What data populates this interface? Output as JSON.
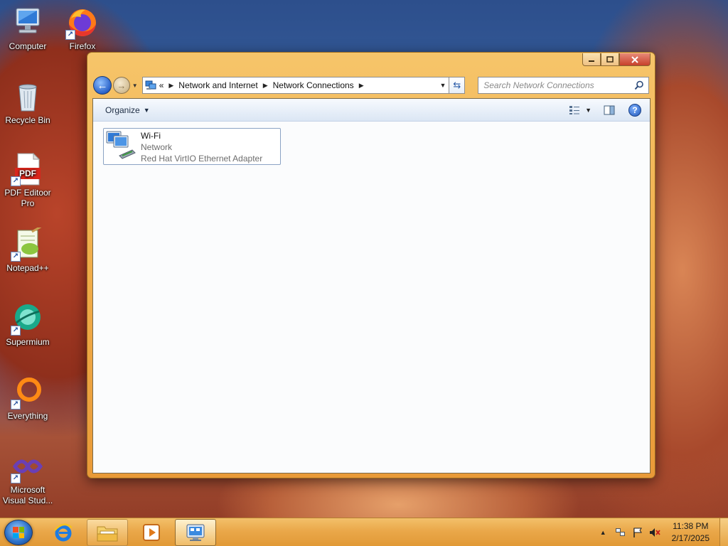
{
  "desktop": {
    "icons": [
      {
        "label": "Computer",
        "icon": "computer-icon"
      },
      {
        "label": "Firefox",
        "icon": "firefox-icon"
      },
      {
        "label": "Recycle Bin",
        "icon": "recycle-bin-icon"
      },
      {
        "label": "PDF Editoor Pro",
        "icon": "pdf-icon"
      },
      {
        "label": "Notepad++",
        "icon": "notepad-plus-plus-icon"
      },
      {
        "label": "Supermium",
        "icon": "supermium-icon"
      },
      {
        "label": "Everything",
        "icon": "everything-icon"
      },
      {
        "label": "Microsoft Visual Stud...",
        "icon": "visual-studio-icon"
      }
    ]
  },
  "window": {
    "breadcrumb": {
      "overflow": "«",
      "items": [
        "Network and Internet",
        "Network Connections"
      ]
    },
    "search_placeholder": "Search Network Connections",
    "toolbar": {
      "organize_label": "Organize",
      "help_label": "?"
    },
    "connections": [
      {
        "name": "Wi-Fi",
        "status": "Network",
        "device": "Red Hat VirtIO Ethernet Adapter"
      }
    ]
  },
  "taskbar": {
    "pinned": [
      "internet-explorer-icon",
      "file-explorer-icon",
      "media-player-icon",
      "network-connections-icon"
    ],
    "clock": {
      "time": "11:38 PM",
      "date": "2/17/2025"
    }
  },
  "colors": {
    "window_frame": "#f0ad4a",
    "taskbar": "#eaa84a",
    "accent_blue": "#2a62c8"
  }
}
